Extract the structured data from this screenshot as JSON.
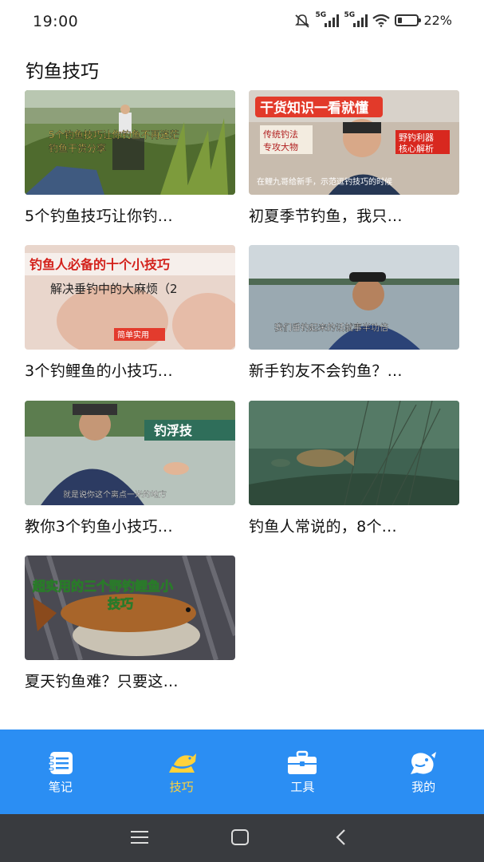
{
  "status": {
    "time": "19:00",
    "signal_tag_1": "5G",
    "signal_tag_2": "5G",
    "battery_pct": "22%",
    "battery_level": 0.22
  },
  "page": {
    "title": "钓鱼技巧"
  },
  "videos": [
    {
      "caption": "5个钓鱼技巧让你钓...",
      "overlay": [
        "5个钓鱼技巧让你钓鱼不再迷茫",
        "钓鱼干货分享"
      ]
    },
    {
      "caption": "初夏季节钓鱼，我只...",
      "overlay": [
        "干货知识一看就懂",
        "传统钓法",
        "专攻大物",
        "野钓利器",
        "核心解析",
        "在鲤九哥给新手，示范逗钓技巧的时候"
      ]
    },
    {
      "caption": "3个钓鲤鱼的小技巧...",
      "overlay": [
        "钓鱼人必备的十个小技巧",
        "解决垂钓中的大麻烦（2",
        "简单实用"
      ]
    },
    {
      "caption": "新手钓友不会钓鱼？...",
      "overlay": [
        "我们垂钓起来的话就事半功倍"
      ]
    },
    {
      "caption": "教你3个钓鱼小技巧...",
      "overlay": [
        "钓浮技",
        "就是说你这个离点一米的地方"
      ]
    },
    {
      "caption": "钓鱼人常说的，8个...",
      "overlay": []
    },
    {
      "caption": "夏天钓鱼难？只要这...",
      "overlay": [
        "超实用的三个野钓鲤鱼小",
        "技巧"
      ]
    }
  ],
  "tabs": [
    {
      "label": "笔记",
      "icon": "notebook-icon",
      "active": false
    },
    {
      "label": "技巧",
      "icon": "fish-icon",
      "active": true
    },
    {
      "label": "工具",
      "icon": "toolbox-icon",
      "active": false
    },
    {
      "label": "我的",
      "icon": "profile-fish-icon",
      "active": false
    }
  ],
  "colors": {
    "tabbar": "#2b8ef3",
    "active_tab": "#ffd23a",
    "navbar": "#393b3f"
  }
}
